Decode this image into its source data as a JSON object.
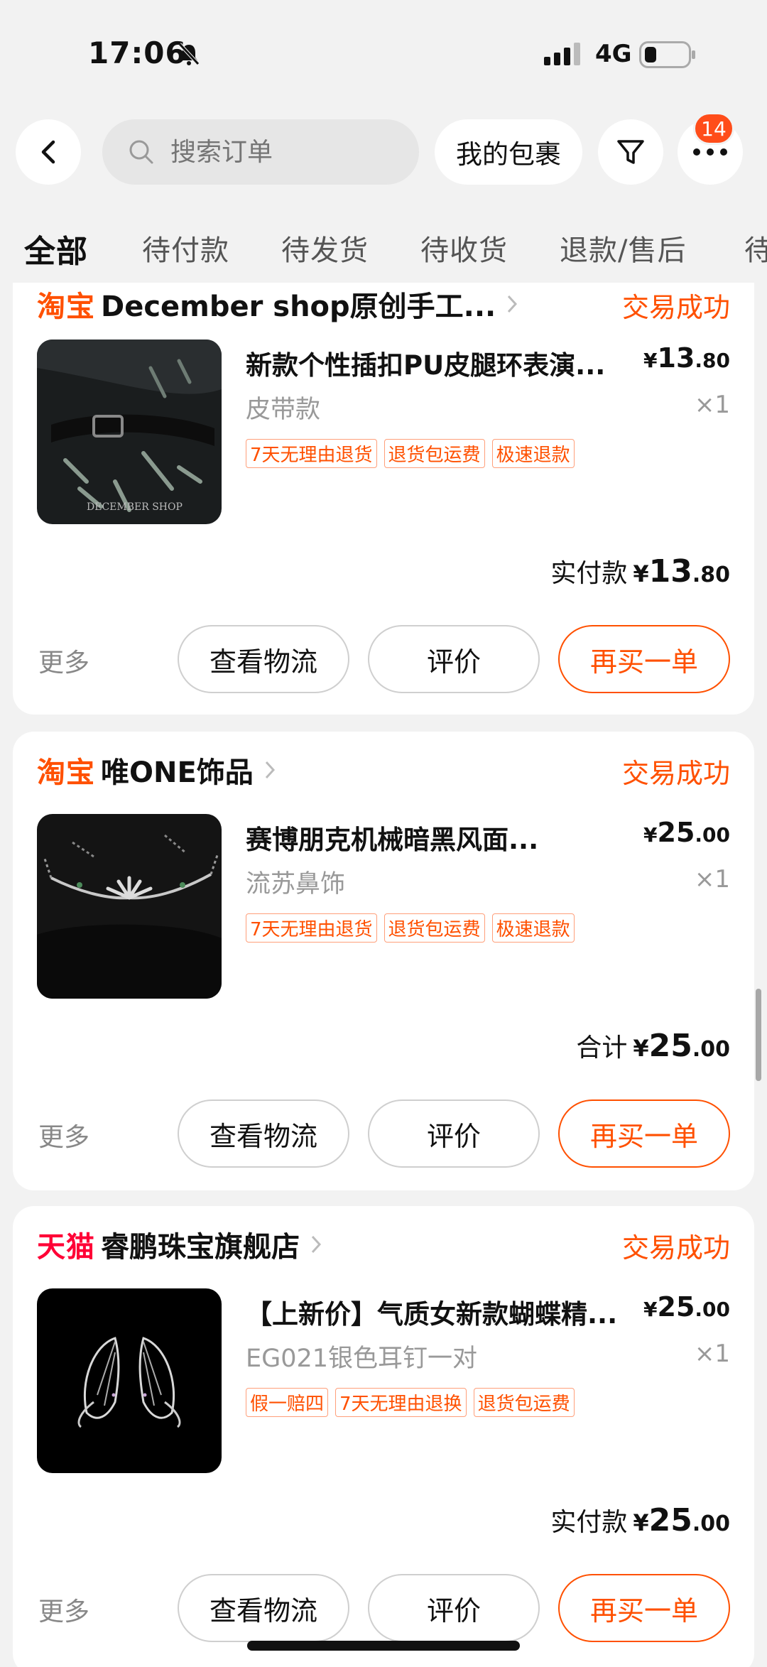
{
  "status_bar": {
    "time": "17:06",
    "network": "4G"
  },
  "search": {
    "placeholder": "搜索订单"
  },
  "header": {
    "package_label": "我的包裹",
    "badge_count": "14"
  },
  "tabs": [
    {
      "label": "全部"
    },
    {
      "label": "待付款"
    },
    {
      "label": "待发货"
    },
    {
      "label": "待收货"
    },
    {
      "label": "退款/售后"
    },
    {
      "label": "待"
    }
  ],
  "orders": [
    {
      "platform": "淘宝",
      "shop": "December shop原创手工...",
      "status": "交易成功",
      "product": {
        "title": "新款个性插扣PU皮腿环表演...",
        "spec": "皮带款",
        "price_int": "13",
        "price_dec": ".80",
        "currency": "¥",
        "qty": "×1",
        "tags": [
          "7天无理由退货",
          "退货包运费",
          "极速退款"
        ],
        "watermark": "DECEMBER SHOP"
      },
      "total_label": "实付款",
      "total_int": "13",
      "total_dec": ".80",
      "more": "更多",
      "actions": {
        "logistics": "查看物流",
        "review": "评价",
        "rebuy": "再买一单"
      }
    },
    {
      "platform": "淘宝",
      "shop": "唯ONE饰品",
      "status": "交易成功",
      "product": {
        "title": "赛博朋克机械暗黑风面...",
        "spec": "流苏鼻饰",
        "price_int": "25",
        "price_dec": ".00",
        "currency": "¥",
        "qty": "×1",
        "tags": [
          "7天无理由退货",
          "退货包运费",
          "极速退款"
        ]
      },
      "total_label": "合计",
      "total_int": "25",
      "total_dec": ".00",
      "more": "更多",
      "actions": {
        "logistics": "查看物流",
        "review": "评价",
        "rebuy": "再买一单"
      }
    },
    {
      "platform": "天猫",
      "shop": "睿鹏珠宝旗舰店",
      "status": "交易成功",
      "product": {
        "title": "【上新价】气质女新款蝴蝶精...",
        "spec": "EG021银色耳钉一对",
        "price_int": "25",
        "price_dec": ".00",
        "currency": "¥",
        "qty": "×1",
        "tags": [
          "假一赔四",
          "7天无理由退换",
          "退货包运费"
        ]
      },
      "total_label": "实付款",
      "total_int": "25",
      "total_dec": ".00",
      "more": "更多",
      "actions": {
        "logistics": "查看物流",
        "review": "评价",
        "rebuy": "再买一单"
      }
    }
  ],
  "colors": {
    "accent": "#ff5000",
    "tmall": "#ff0036",
    "badge": "#ff4d1a",
    "background": "#f2f2f2"
  }
}
